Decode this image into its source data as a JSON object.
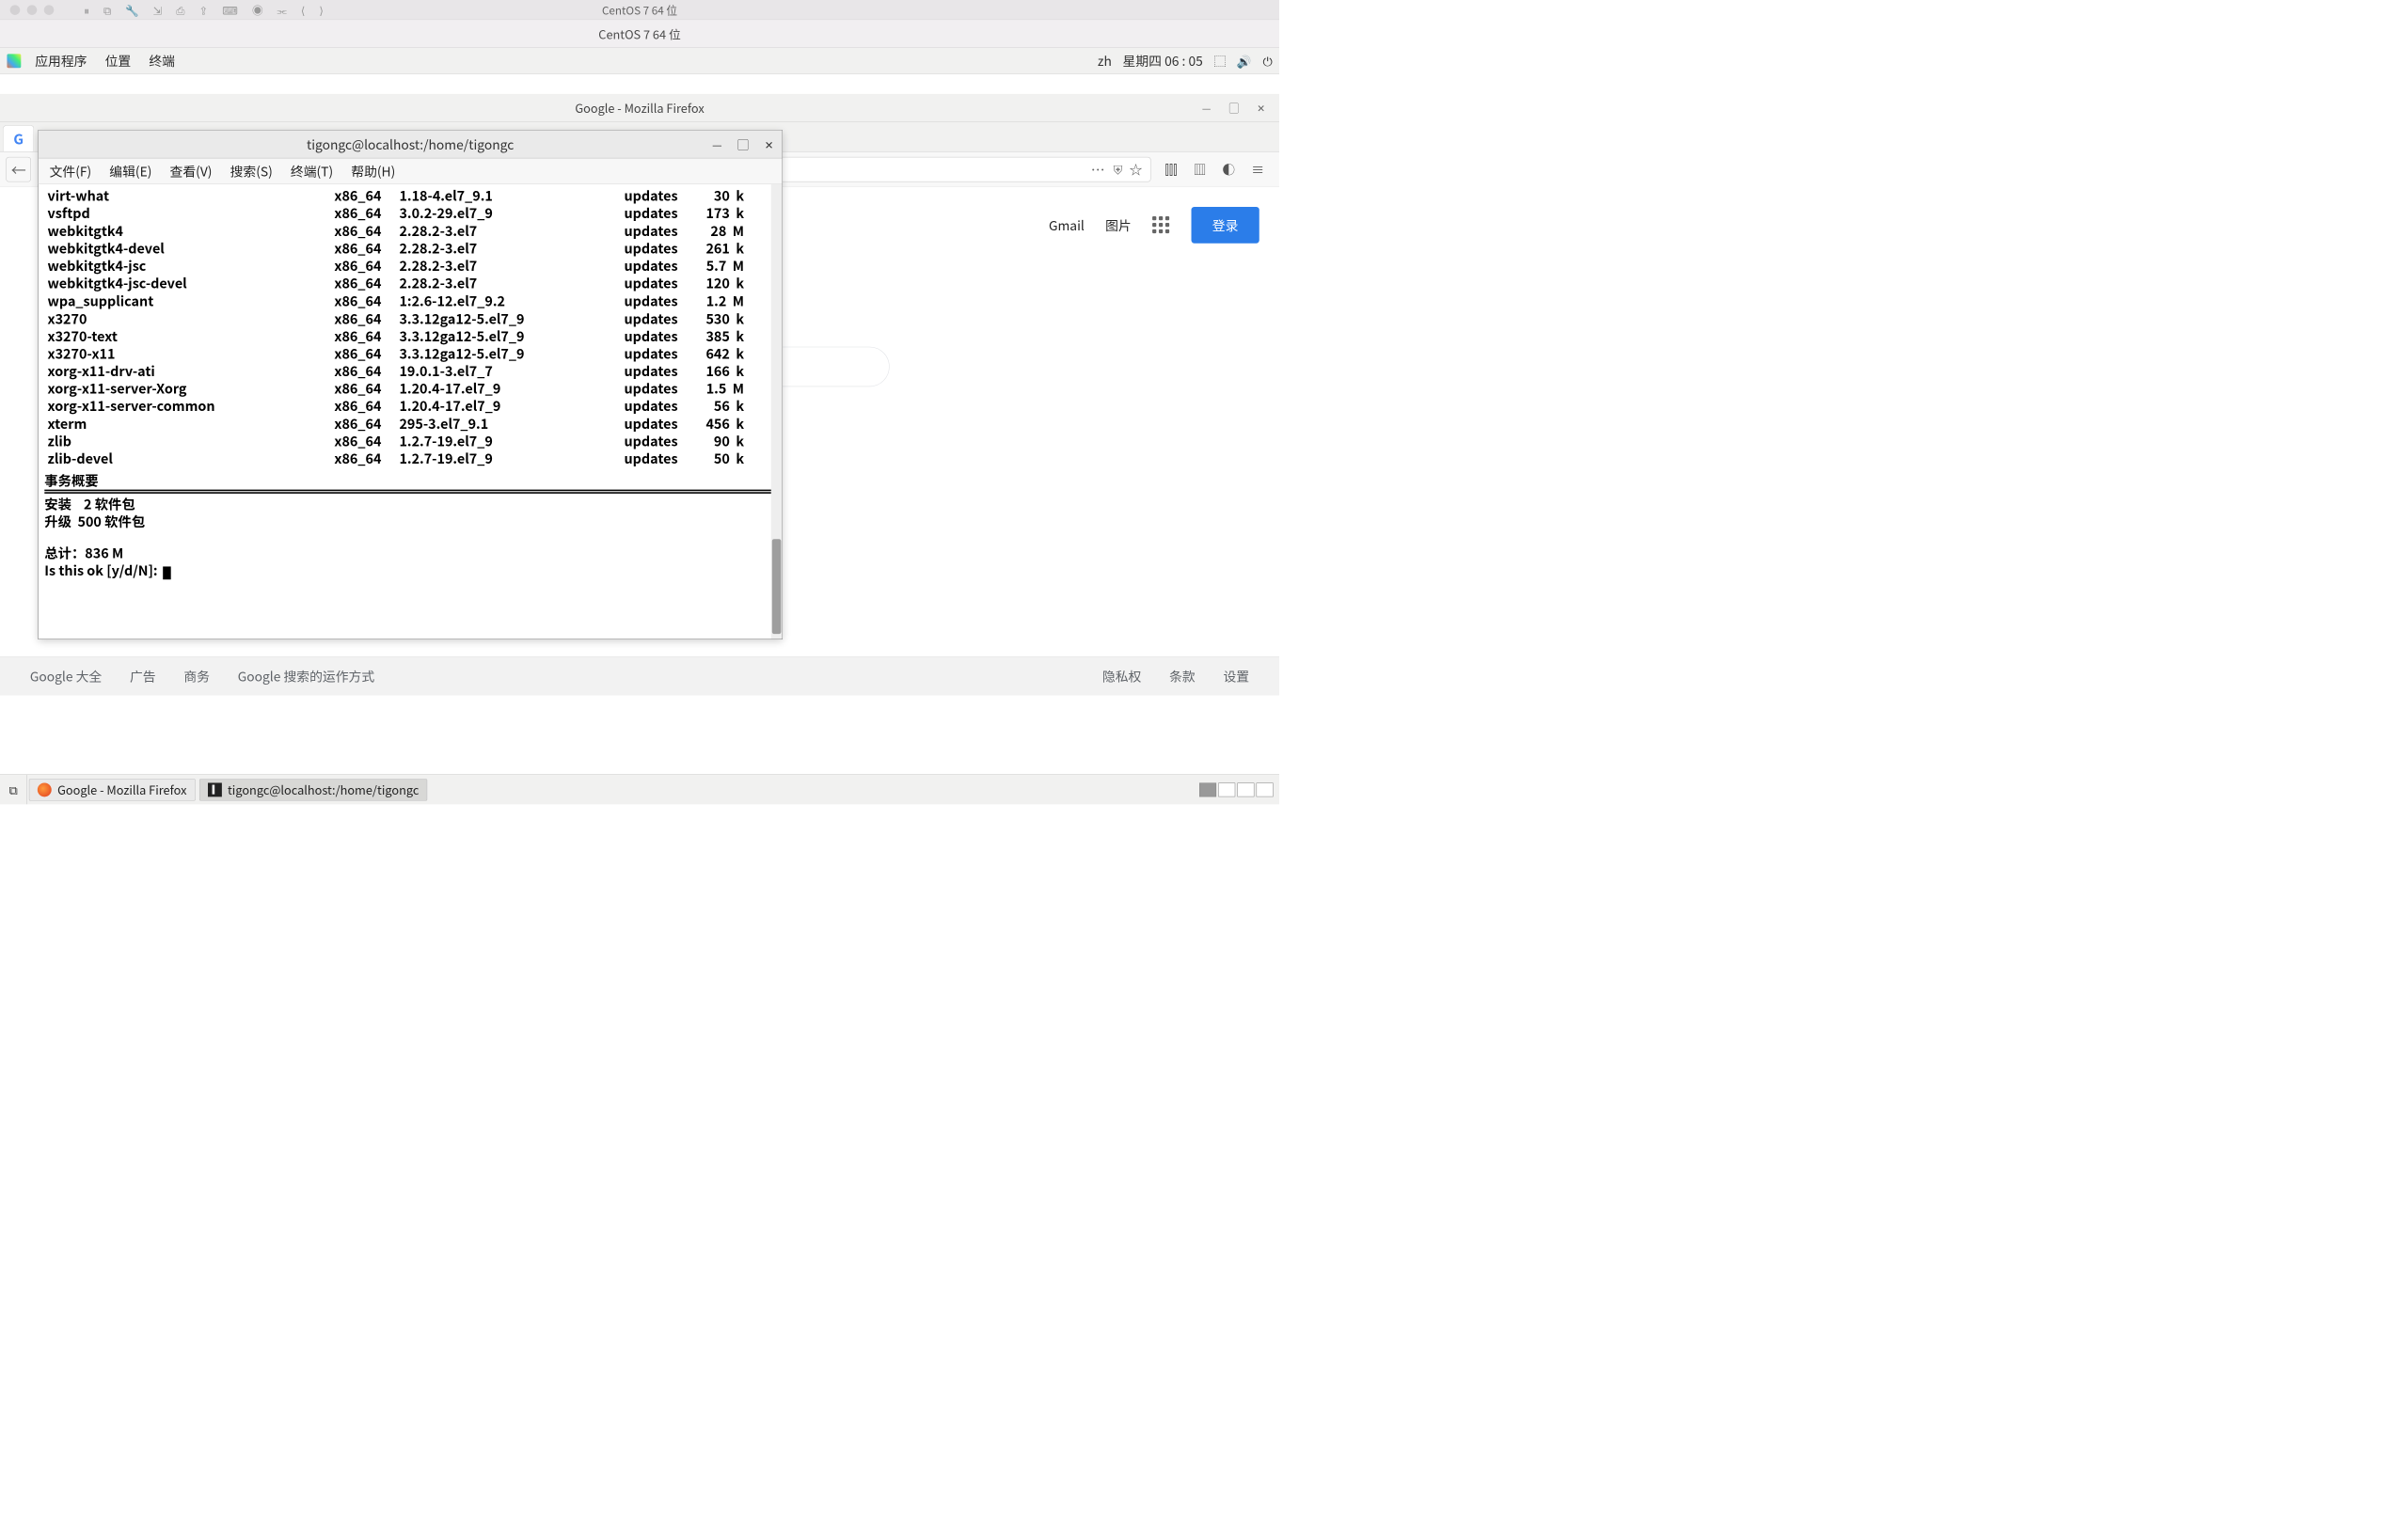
{
  "vm": {
    "title": "CentOS 7 64 位"
  },
  "infobar": "CentOS 7 64 位",
  "gnome": {
    "menus": [
      "应用程序",
      "位置",
      "终端"
    ],
    "lang": "zh",
    "clock": "星期四 06 : 05"
  },
  "firefox": {
    "title": "Google - Mozilla Firefox",
    "tab_letter": "G",
    "top_links": {
      "gmail": "Gmail",
      "images": "图片",
      "login": "登录"
    },
    "footer": {
      "about": "Google 大全",
      "ads": "广告",
      "business": "商务",
      "how": "Google 搜索的运作方式",
      "privacy": "隐私权",
      "terms": "条款",
      "settings": "设置"
    }
  },
  "taskbar": {
    "firefox": "Google - Mozilla Firefox",
    "terminal": "tigongc@localhost:/home/tigongc"
  },
  "terminal": {
    "title": "tigongc@localhost:/home/tigongc",
    "menus": [
      "文件(F)",
      "编辑(E)",
      "查看(V)",
      "搜索(S)",
      "终端(T)",
      "帮助(H)"
    ],
    "packages": [
      {
        "name": " virt-what",
        "arch": "x86_64",
        "ver": "1.18-4.el7_9.1",
        "repo": "updates",
        "size": " 30  k"
      },
      {
        "name": " vsftpd",
        "arch": "x86_64",
        "ver": "3.0.2-29.el7_9",
        "repo": "updates",
        "size": "173  k"
      },
      {
        "name": " webkitgtk4",
        "arch": "x86_64",
        "ver": "2.28.2-3.el7",
        "repo": "updates",
        "size": " 28  M"
      },
      {
        "name": " webkitgtk4-devel",
        "arch": "x86_64",
        "ver": "2.28.2-3.el7",
        "repo": "updates",
        "size": "261  k"
      },
      {
        "name": " webkitgtk4-jsc",
        "arch": "x86_64",
        "ver": "2.28.2-3.el7",
        "repo": "updates",
        "size": "5.7  M"
      },
      {
        "name": " webkitgtk4-jsc-devel",
        "arch": "x86_64",
        "ver": "2.28.2-3.el7",
        "repo": "updates",
        "size": "120  k"
      },
      {
        "name": " wpa_supplicant",
        "arch": "x86_64",
        "ver": "1:2.6-12.el7_9.2",
        "repo": "updates",
        "size": "1.2  M"
      },
      {
        "name": " x3270",
        "arch": "x86_64",
        "ver": "3.3.12ga12-5.el7_9",
        "repo": "updates",
        "size": "530  k"
      },
      {
        "name": " x3270-text",
        "arch": "x86_64",
        "ver": "3.3.12ga12-5.el7_9",
        "repo": "updates",
        "size": "385  k"
      },
      {
        "name": " x3270-x11",
        "arch": "x86_64",
        "ver": "3.3.12ga12-5.el7_9",
        "repo": "updates",
        "size": "642  k"
      },
      {
        "name": " xorg-x11-drv-ati",
        "arch": "x86_64",
        "ver": "19.0.1-3.el7_7",
        "repo": "updates",
        "size": "166  k"
      },
      {
        "name": " xorg-x11-server-Xorg",
        "arch": "x86_64",
        "ver": "1.20.4-17.el7_9",
        "repo": "updates",
        "size": "1.5  M"
      },
      {
        "name": " xorg-x11-server-common",
        "arch": "x86_64",
        "ver": "1.20.4-17.el7_9",
        "repo": "updates",
        "size": " 56  k"
      },
      {
        "name": " xterm",
        "arch": "x86_64",
        "ver": "295-3.el7_9.1",
        "repo": "updates",
        "size": "456  k"
      },
      {
        "name": " zlib",
        "arch": "x86_64",
        "ver": "1.2.7-19.el7_9",
        "repo": "updates",
        "size": " 90  k"
      },
      {
        "name": " zlib-devel",
        "arch": "x86_64",
        "ver": "1.2.7-19.el7_9",
        "repo": "updates",
        "size": " 50  k"
      }
    ],
    "summary_title": "事务概要",
    "install_line": "安装    2 软件包",
    "upgrade_line": "升级  500 软件包",
    "total_line": "总计：836 M",
    "prompt": "Is this ok [y/d/N]: "
  }
}
